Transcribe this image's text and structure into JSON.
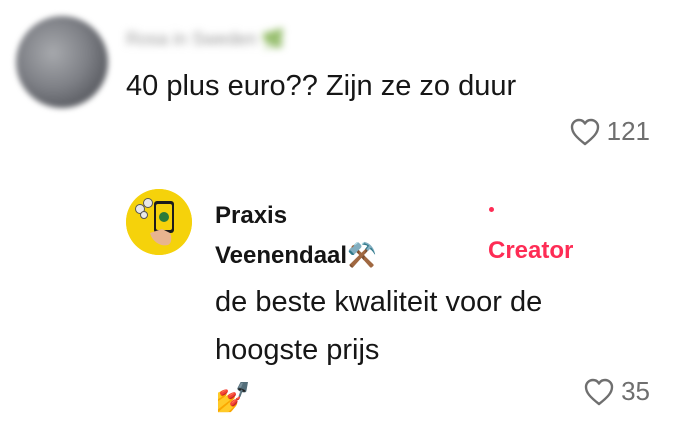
{
  "comment": {
    "username": "Rosa in Sweden",
    "username_emoji": "🌿",
    "text": "40 plus euro?? Zijn ze zo duur",
    "likes": "121"
  },
  "reply": {
    "name_line1": "Praxis",
    "name_line2": "Veenendaal",
    "name_emoji": "⚒️",
    "badge": "Creator",
    "text_line1": "de beste kwaliteit voor de",
    "text_line2": "hoogste prijs",
    "text_emoji": "💅",
    "likes": "35"
  },
  "colors": {
    "accent": "#fe2c55",
    "brand_yellow": "#f5d20b",
    "muted": "#6f6f6f"
  },
  "icons": [
    "heart-outline-icon",
    "hammer-pick-icon",
    "nail-polish-icon"
  ]
}
